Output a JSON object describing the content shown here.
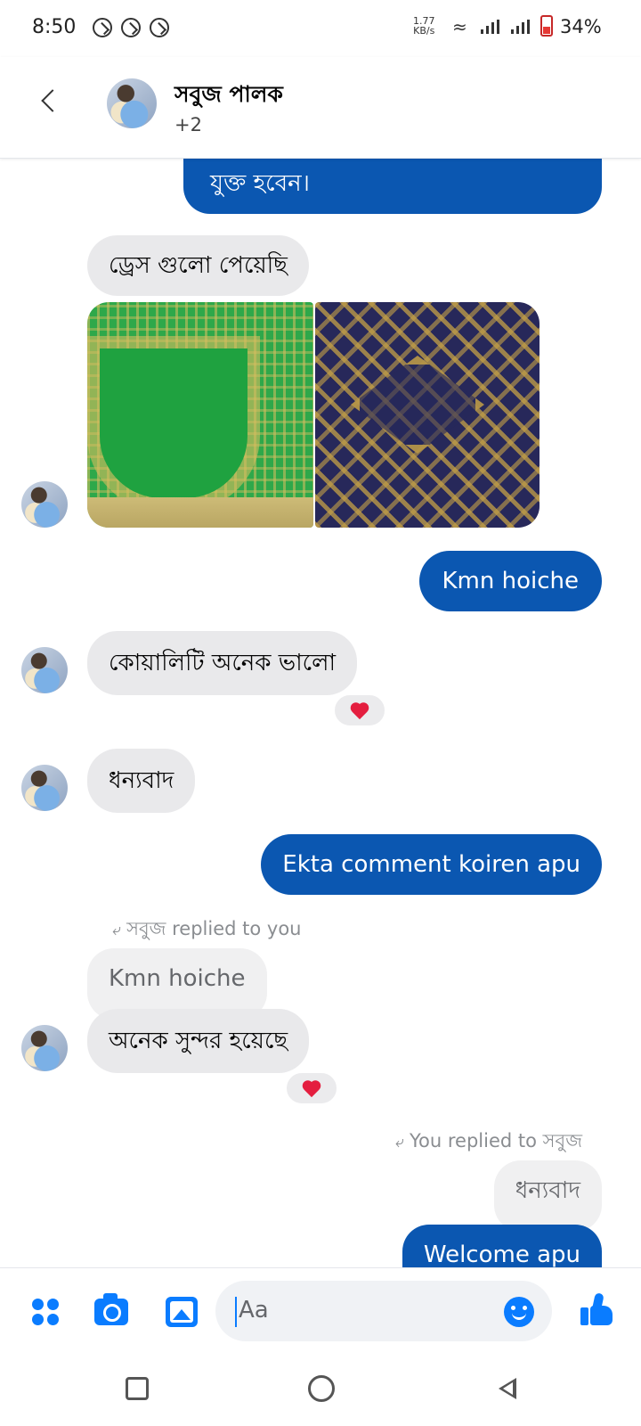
{
  "status_bar": {
    "time": "8:50",
    "network_speed_value": "1.77",
    "network_speed_unit": "KB/s",
    "battery": "34%"
  },
  "header": {
    "name": "সবুজ পালক",
    "participants_extra": "+2"
  },
  "messages": [
    {
      "id": "m0",
      "side": "out",
      "text": "যুক্ত হবেন।"
    },
    {
      "id": "m1",
      "side": "in",
      "text": "ড্রেস গুলো পেয়েছি"
    },
    {
      "id": "m3",
      "side": "out",
      "text": "Kmn hoiche"
    },
    {
      "id": "m4",
      "side": "in",
      "text": "কোয়ালিটি অনেক ভালো",
      "reaction": "heart"
    },
    {
      "id": "m5",
      "side": "in",
      "text": "ধন্যবাদ"
    },
    {
      "id": "m6",
      "side": "out",
      "text": "Ekta comment koiren apu"
    },
    {
      "id": "m7",
      "side": "in",
      "reply_label": "সবুজ replied to you",
      "quoted": "Kmn hoiche",
      "text": "অনেক সুন্দর হয়েছে",
      "reaction": "heart"
    },
    {
      "id": "m8",
      "side": "out",
      "reply_label": "You replied to সবুজ",
      "quoted": "ধন্যবাদ",
      "text": "Welcome apu"
    }
  ],
  "composer": {
    "placeholder": "Aa"
  },
  "colors": {
    "outgoing_bubble": "#0b57b1",
    "incoming_bubble": "#e9e9eb",
    "accent": "#0a7cff",
    "reaction_heart": "#e41e3f"
  },
  "icons": [
    "back-icon",
    "menu-dots-icon",
    "camera-icon",
    "gallery-icon",
    "emoji-icon",
    "like-icon",
    "reply-arrow-icon",
    "heart-icon",
    "nav-recents-icon",
    "nav-home-icon",
    "nav-back-icon"
  ]
}
